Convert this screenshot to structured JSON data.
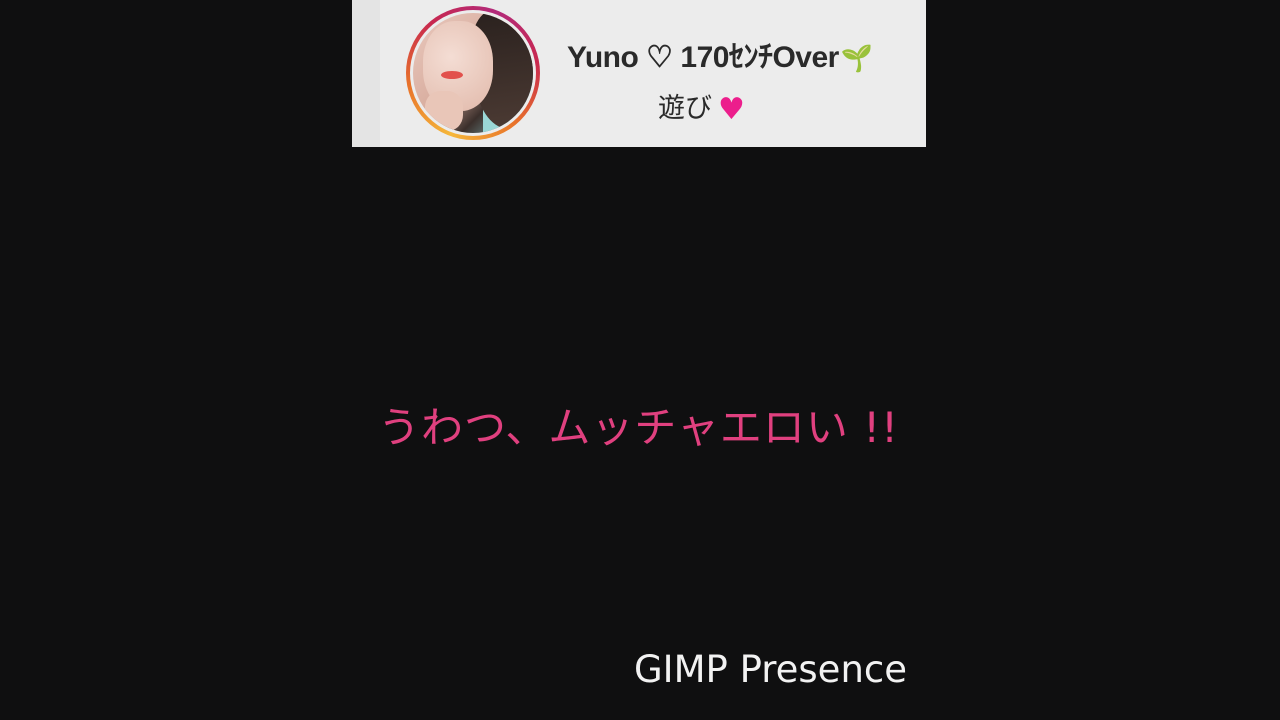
{
  "profile": {
    "name": "Yuno ♡ 170ｾﾝﾁOver",
    "name_emoji": "🌱",
    "bio": "遊び",
    "bio_emoji": "♥"
  },
  "subtitle": "うわつ、ムッチャエロい !!",
  "watermark": "GIMP Presence",
  "icons": {
    "avatar": "avatar-photo",
    "sprout": "sprout-icon",
    "heart": "heart-icon"
  },
  "colors": {
    "background": "#0f0f10",
    "card": "#ececec",
    "subtitle": "#e0407f",
    "heart": "#ec1e8c"
  }
}
